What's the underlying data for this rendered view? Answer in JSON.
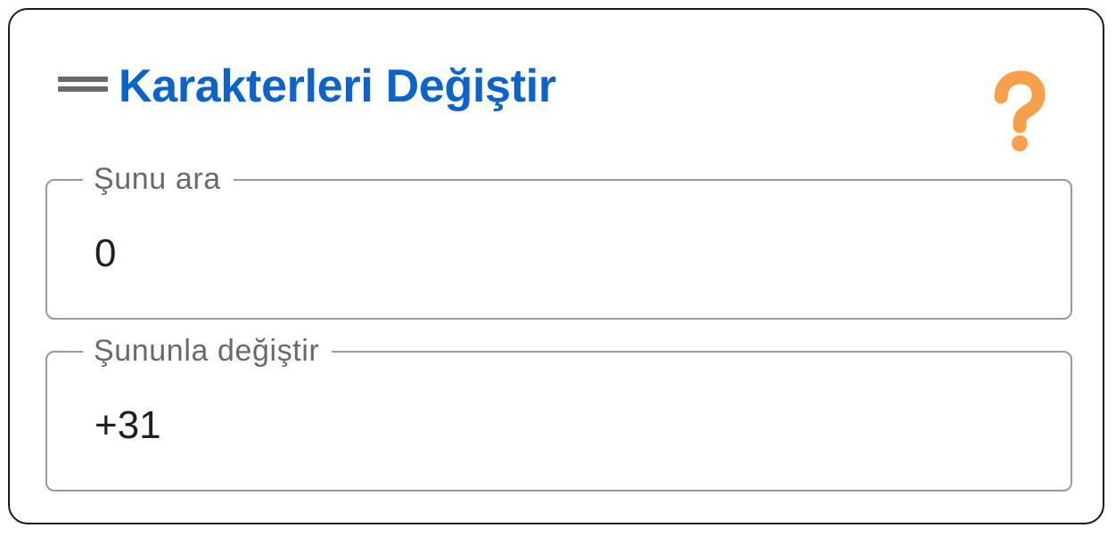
{
  "panel": {
    "title": "Karakterleri Değiştir",
    "title_color": "#0b63ce",
    "drag_handle_icon": "drag-handle-icon",
    "help_icon": "question-mark-icon",
    "help_icon_color": "#f7a04a"
  },
  "fields": {
    "find": {
      "label": "Şunu ara",
      "value": "0"
    },
    "replace": {
      "label": "Şununla değiştir",
      "value": "+31"
    }
  }
}
